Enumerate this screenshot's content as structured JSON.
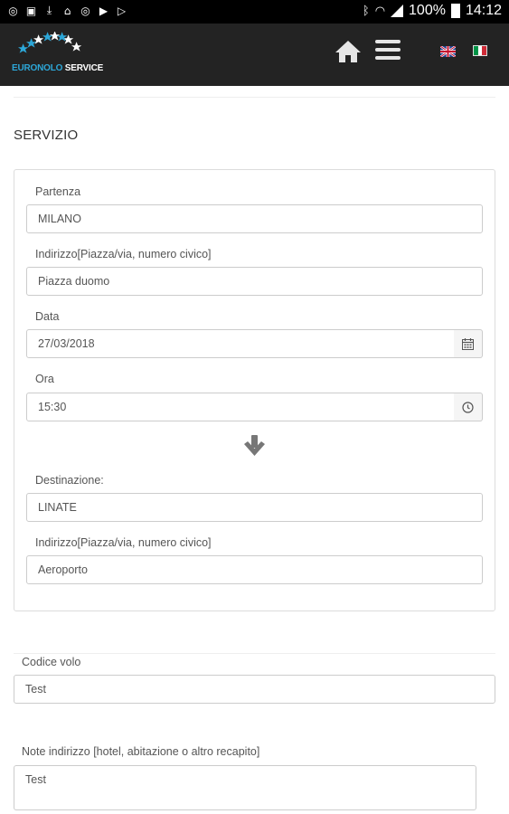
{
  "status_bar": {
    "battery": "100%",
    "time": "14:12"
  },
  "header": {
    "logo_part1": "EURONOLO",
    "logo_part2": " SERVICE",
    "home_icon": "home-icon",
    "menu_icon": "hamburger-menu-icon",
    "languages": [
      "en",
      "it"
    ]
  },
  "section": {
    "title": "SERVIZIO"
  },
  "form": {
    "partenza_label": "Partenza",
    "partenza_value": "MILANO",
    "indirizzo_label": "Indirizzo[Piazza/via, numero civico]",
    "indirizzo_value": "Piazza duomo",
    "data_label": "Data",
    "data_value": "27/03/2018",
    "ora_label": "Ora",
    "ora_value": "15:30",
    "destinazione_label": "Destinazione:",
    "destinazione_value": "LINATE",
    "indirizzo_dest_label": "Indirizzo[Piazza/via, numero civico]",
    "indirizzo_dest_value": "Aeroporto",
    "codice_volo_label": "Codice volo",
    "codice_volo_value": "Test",
    "note_label": "Note indirizzo [hotel, abitazione o altro recapito]",
    "note_value": "Test"
  },
  "colors": {
    "header_bg": "#232323",
    "logo_accent": "#2da7d8",
    "arrow": "#777777"
  }
}
